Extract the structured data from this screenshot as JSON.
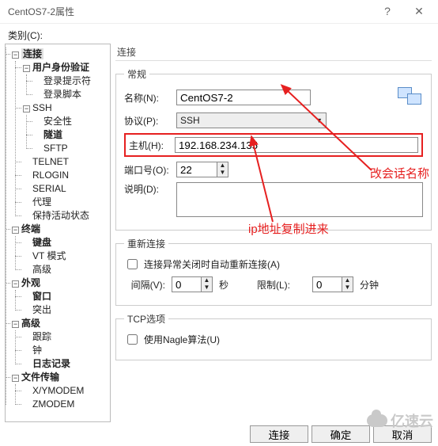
{
  "window": {
    "title": "CentOS7-2属性"
  },
  "category_label": "类别(C):",
  "tree": {
    "root": "连接",
    "n_user_auth": "用户身份验证",
    "n_login_prompt": "登录提示符",
    "n_login_script": "登录脚本",
    "n_ssh": "SSH",
    "n_security": "安全性",
    "n_tunnel": "隧道",
    "n_sftp": "SFTP",
    "n_telnet": "TELNET",
    "n_rlogin": "RLOGIN",
    "n_serial": "SERIAL",
    "n_proxy": "代理",
    "n_keepalive": "保持活动状态",
    "n_terminal": "终端",
    "n_keyboard": "键盘",
    "n_vt": "VT 模式",
    "n_advanced": "高级",
    "n_appearance": "外观",
    "n_window": "窗口",
    "n_highlight": "突出",
    "n_advanced2": "高级",
    "n_trace": "跟踪",
    "n_bell": "钟",
    "n_logging": "日志记录",
    "n_ft": "文件传输",
    "n_xy": "X/YMODEM",
    "n_z": "ZMODEM"
  },
  "right_header": "连接",
  "groups": {
    "general": "常规",
    "reconnect": "重新连接",
    "tcp": "TCP选项"
  },
  "labels": {
    "name": "名称(N):",
    "protocol": "协议(P):",
    "host": "主机(H):",
    "port": "端口号(O):",
    "desc": "说明(D):",
    "auto_reconnect": "连接异常关闭时自动重新连接(A)",
    "interval": "间隔(V):",
    "sec": "秒",
    "limit": "限制(L):",
    "min": "分钟",
    "nagle": "使用Nagle算法(U)"
  },
  "values": {
    "name": "CentOS7-2",
    "protocol": "SSH",
    "host": "192.168.234.135",
    "port": "22",
    "desc": "",
    "interval": "0",
    "limit": "0"
  },
  "buttons": {
    "connect": "连接",
    "ok": "确定",
    "cancel": "取消"
  },
  "annotations": {
    "rename": "改会话名称",
    "ip_paste": "ip地址复制进来"
  },
  "watermark": "亿速云"
}
